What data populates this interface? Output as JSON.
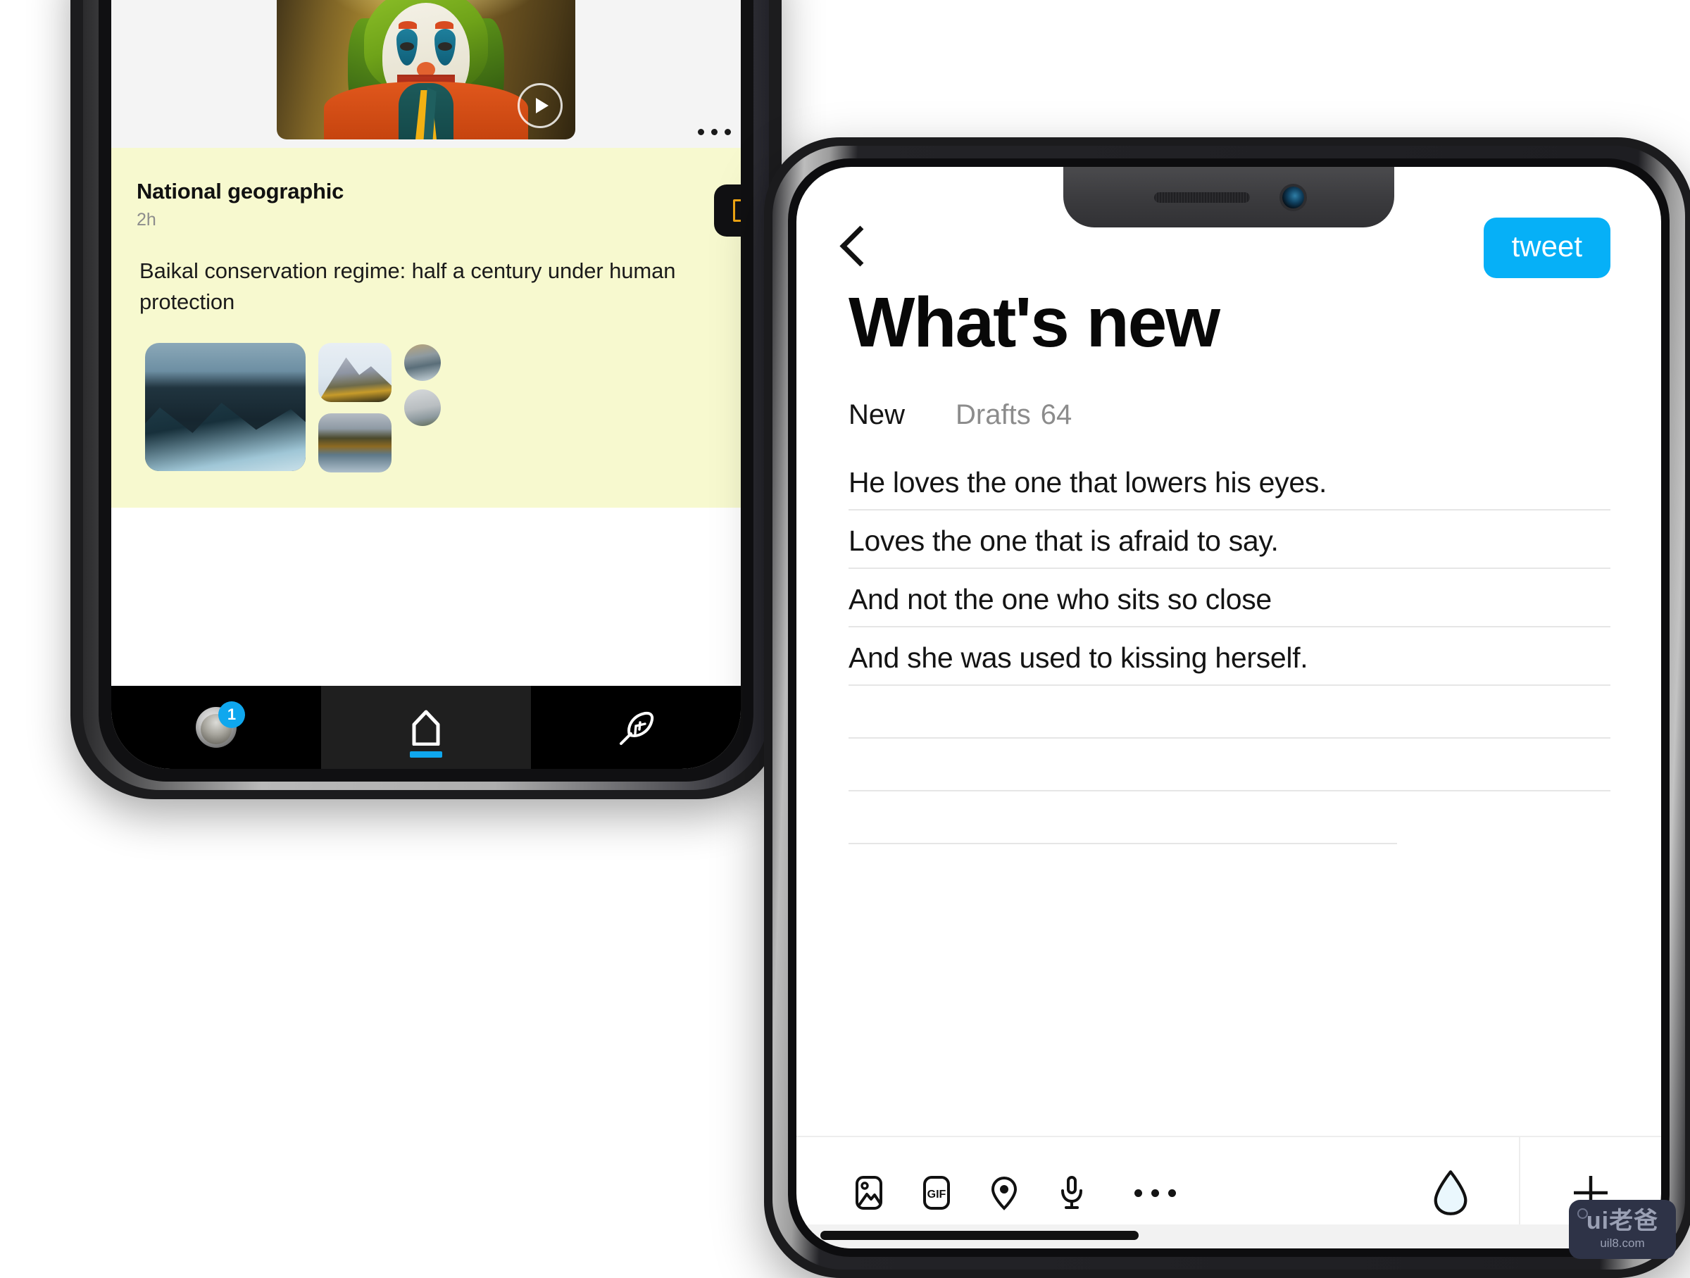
{
  "left_phone": {
    "media_card": {
      "video_alt": "joker-video-thumbnail",
      "play_icon": "play-icon",
      "more_icon": "ellipsis-icon"
    },
    "post": {
      "author": "National geographic",
      "time": "2h",
      "text": "Baikal conservation regime: half a century under human protection",
      "bookmark_icon": "bookmark-icon",
      "photos": [
        "mountain-range-photo",
        "snow-peak-photo",
        "lake-mountain-photo",
        "circle-photo-a",
        "circle-photo-b"
      ]
    },
    "tabbar": {
      "avatar_badge": "1",
      "items": [
        {
          "name": "profile",
          "icon": "avatar"
        },
        {
          "name": "home",
          "icon": "home-icon",
          "active": true
        },
        {
          "name": "compose",
          "icon": "feather-icon"
        }
      ]
    }
  },
  "right_phone": {
    "topbar": {
      "back_icon": "chevron-left-icon",
      "tweet_label": "tweet",
      "tweet_color": "#06b0f7"
    },
    "title": "What's new",
    "tabs": [
      {
        "label": "New",
        "active": true
      },
      {
        "label": "Drafts",
        "count": "64",
        "active": false
      }
    ],
    "lines": [
      "He loves the one that lowers his eyes.",
      "Loves the one that is afraid to say.",
      "And not the one who sits so close",
      "And she was used to kissing herself.",
      "",
      "",
      ""
    ],
    "toolbar": {
      "items": [
        {
          "name": "image-icon",
          "label": ""
        },
        {
          "name": "gif-icon",
          "label": "GIF"
        },
        {
          "name": "location-pin-icon",
          "label": ""
        },
        {
          "name": "microphone-icon",
          "label": ""
        },
        {
          "name": "ellipsis-icon",
          "label": ""
        },
        {
          "name": "water-drop-icon",
          "label": ""
        }
      ],
      "add_icon": "plus-icon"
    }
  },
  "watermark": {
    "main": "ui老爸",
    "sub": "uil8.com"
  }
}
